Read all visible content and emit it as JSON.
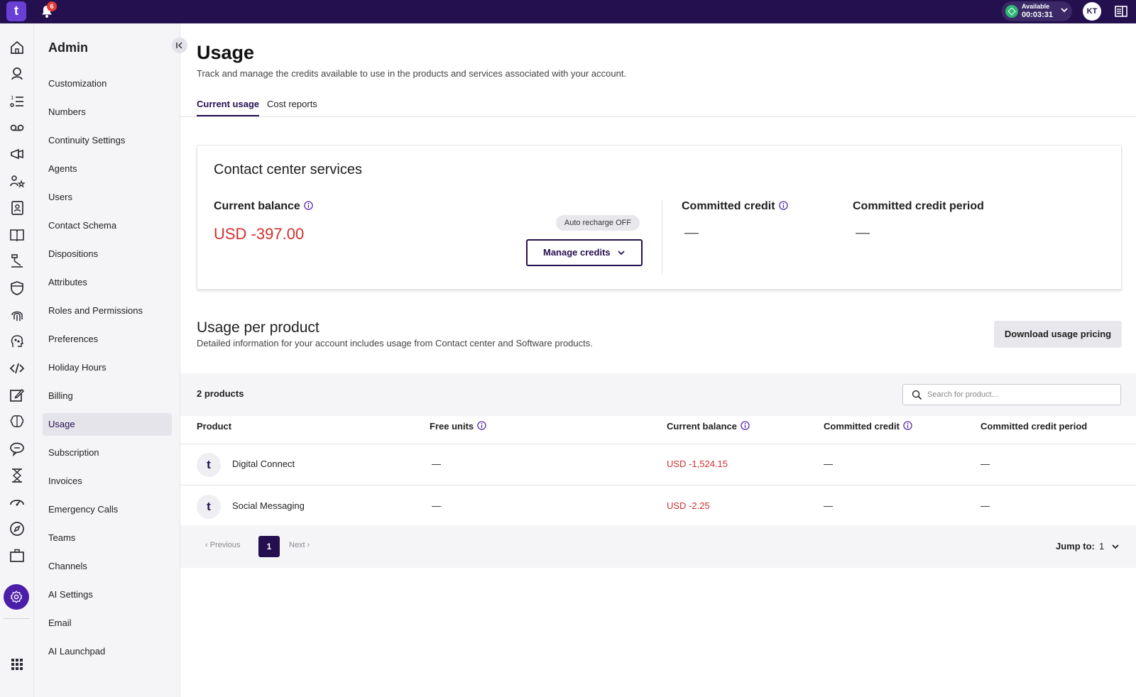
{
  "topbar": {
    "logo_text": "t",
    "notification_count": "6",
    "status_label": "Available",
    "status_time": "00:03:31",
    "avatar_initials": "KT"
  },
  "rail": {
    "icons": [
      "home-icon",
      "agent-icon",
      "list-icon",
      "voicemail-icon",
      "megaphone-icon",
      "people-star-icon",
      "contact-book-icon",
      "book-icon",
      "flow-icon",
      "shield-icon",
      "fingerprint-icon",
      "ai-face-icon",
      "code-icon",
      "edit-icon",
      "brain-icon",
      "chat-icon",
      "hourglass-icon",
      "speedometer-icon",
      "compass-icon",
      "briefcase-icon",
      "settings-icon",
      "apps-grid-icon"
    ]
  },
  "admin": {
    "title": "Admin",
    "items": [
      "Customization",
      "Numbers",
      "Continuity Settings",
      "Agents",
      "Users",
      "Contact Schema",
      "Dispositions",
      "Attributes",
      "Roles and Permissions",
      "Preferences",
      "Holiday Hours",
      "Billing",
      "Usage",
      "Subscription",
      "Invoices",
      "Emergency Calls",
      "Teams",
      "Channels",
      "AI Settings",
      "Email",
      "AI Launchpad"
    ],
    "active": "Usage"
  },
  "page": {
    "title": "Usage",
    "subtitle": "Track and manage the credits available to use in the products and services associated with your account.",
    "tabs": [
      "Current usage",
      "Cost reports"
    ],
    "active_tab": "Current usage"
  },
  "contact_center": {
    "title": "Contact center services",
    "current_balance_label": "Current balance",
    "current_balance_value": "USD -397.00",
    "auto_recharge": "Auto recharge OFF",
    "manage_credits": "Manage credits",
    "committed_credit_label": "Committed credit",
    "committed_credit_value": "—",
    "committed_period_label": "Committed credit period",
    "committed_period_value": "—"
  },
  "usage_per_product": {
    "title": "Usage per product",
    "subtitle": "Detailed information for your account includes usage from Contact center and Software products.",
    "download_button": "Download usage pricing",
    "count": "2 products",
    "search_placeholder": "Search for product...",
    "columns": [
      "Product",
      "Free units",
      "Current balance",
      "Committed credit",
      "Committed credit period"
    ],
    "rows": [
      {
        "product": "Digital Connect",
        "free_units": "—",
        "balance": "USD -1,524.15",
        "committed": "—",
        "period": "—"
      },
      {
        "product": "Social Messaging",
        "free_units": "—",
        "balance": "USD -2.25",
        "committed": "—",
        "period": "—"
      }
    ],
    "pager": {
      "previous": "Previous",
      "current": "1",
      "next": "Next",
      "jump_label": "Jump to:",
      "jump_value": "1"
    }
  },
  "colors": {
    "brand_dark": "#25104f",
    "brand_purple": "#4a1ea8",
    "negative": "#d32f2f",
    "status_green": "#2bb673"
  }
}
